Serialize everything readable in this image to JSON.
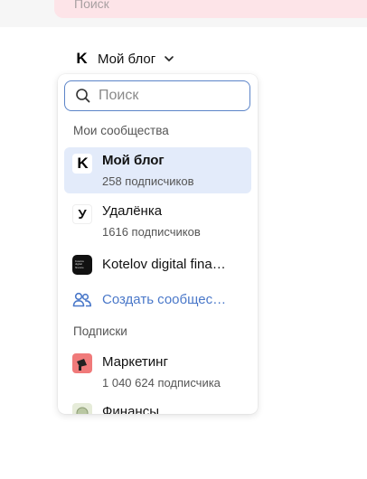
{
  "top_search": {
    "placeholder": "Поиск"
  },
  "blog_switcher": {
    "label": "Мой блог",
    "logo_letter": "K"
  },
  "dropdown": {
    "search_placeholder": "Поиск",
    "communities_title": "Мои сообщества",
    "communities": [
      {
        "name": "Мой блог",
        "subscribers": "258 подписчиков",
        "avatar": "K",
        "selected": true
      },
      {
        "name": "Удалёнка",
        "subscribers": "1616 подписчиков",
        "avatar": "У"
      },
      {
        "name": "Kotelov digital fina…",
        "avatar_text": "Kotelov digital finance"
      }
    ],
    "create_label": "Создать сообщес…",
    "subscriptions_title": "Подписки",
    "subscriptions": [
      {
        "name": "Маркетинг",
        "subscribers": "1 040 624 подписчика",
        "icon": "megaphone-icon"
      },
      {
        "name": "Финансы",
        "icon": "coin-icon"
      }
    ]
  },
  "colors": {
    "accent": "#4a78c9",
    "selected_bg": "#e3ebfa",
    "top_search_bg": "#fde4e8",
    "marketing_icon_bg": "#f07a7a"
  }
}
